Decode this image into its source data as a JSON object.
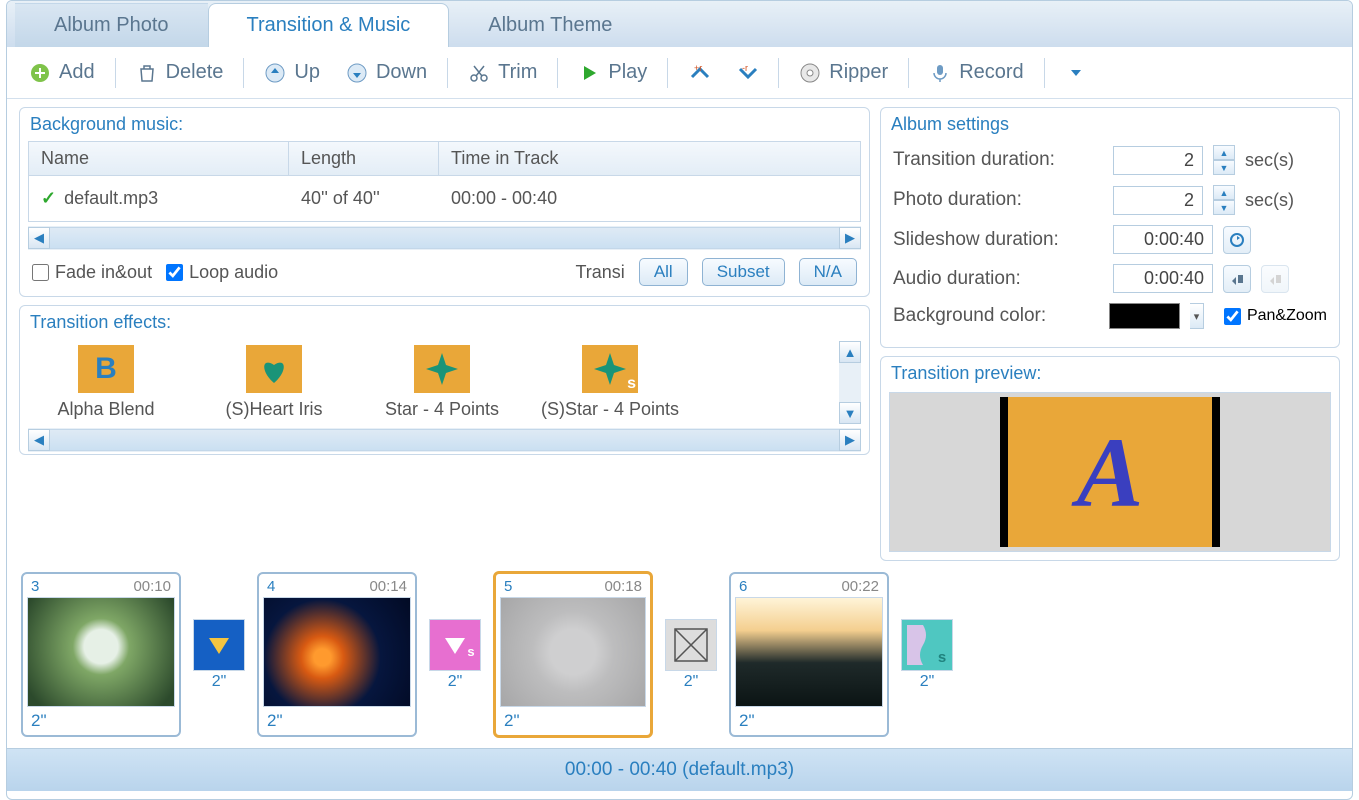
{
  "tabs": {
    "album_photo": "Album Photo",
    "transition_music": "Transition & Music",
    "album_theme": "Album Theme"
  },
  "toolbar": {
    "add": "Add",
    "delete": "Delete",
    "up": "Up",
    "down": "Down",
    "trim": "Trim",
    "play": "Play",
    "ripper": "Ripper",
    "record": "Record"
  },
  "bg_music": {
    "title": "Background music:",
    "cols": {
      "name": "Name",
      "length": "Length",
      "time": "Time in Track"
    },
    "rows": [
      {
        "name": "default.mp3",
        "length": "40'' of 40''",
        "time": "00:00 - 00:40"
      }
    ],
    "fade": "Fade in&out",
    "fade_checked": false,
    "loop": "Loop audio",
    "loop_checked": true,
    "trans_lbl": "Transi",
    "btn_all": "All",
    "btn_subset": "Subset",
    "btn_na": "N/A"
  },
  "fx": {
    "title": "Transition effects:",
    "items": [
      {
        "label": "Alpha Blend"
      },
      {
        "label": "(S)Heart Iris"
      },
      {
        "label": "Star - 4 Points"
      },
      {
        "label": "(S)Star - 4 Points"
      }
    ]
  },
  "settings": {
    "title": "Album settings",
    "trans_dur_lbl": "Transition duration:",
    "trans_dur": "2",
    "secs": "sec(s)",
    "photo_dur_lbl": "Photo duration:",
    "photo_dur": "2",
    "slide_dur_lbl": "Slideshow duration:",
    "slide_dur": "0:00:40",
    "audio_dur_lbl": "Audio duration:",
    "audio_dur": "0:00:40",
    "bgcolor_lbl": "Background color:",
    "bgcolor": "#000000",
    "panzoom": "Pan&Zoom",
    "panzoom_checked": true
  },
  "preview": {
    "title": "Transition preview:",
    "letter": "A"
  },
  "timeline": {
    "slides": [
      {
        "n": "3",
        "t": "00:10",
        "dur": "2\""
      },
      {
        "n": "4",
        "t": "00:14",
        "dur": "2\""
      },
      {
        "n": "5",
        "t": "00:18",
        "dur": "2\"",
        "sel": true
      },
      {
        "n": "6",
        "t": "00:22",
        "dur": "2\""
      }
    ],
    "trs": [
      {
        "dur": "2\""
      },
      {
        "dur": "2\""
      },
      {
        "dur": "2\""
      },
      {
        "dur": "2\""
      }
    ]
  },
  "status": "00:00 - 00:40 (default.mp3)"
}
